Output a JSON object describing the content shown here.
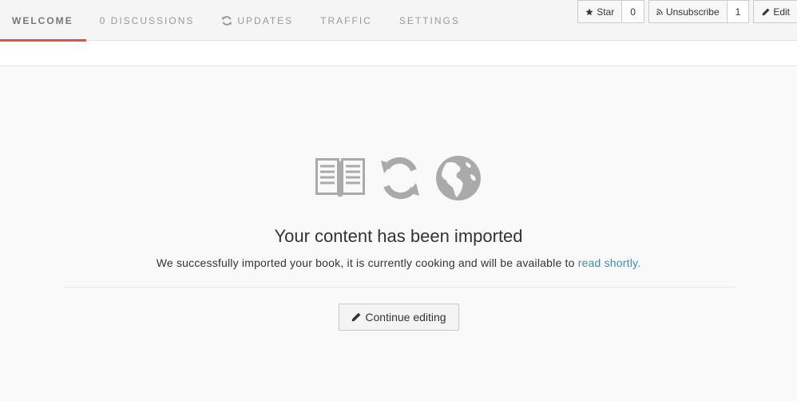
{
  "tabs": [
    {
      "label": "Welcome",
      "active": true
    },
    {
      "label": "0 Discussions"
    },
    {
      "label": "Updates",
      "icon": "refresh-icon"
    },
    {
      "label": "Traffic"
    },
    {
      "label": "Settings"
    }
  ],
  "actions": {
    "star_label": "Star",
    "star_count": "0",
    "unsubscribe_label": "Unsubscribe",
    "subscriber_count": "1",
    "edit_label": "Edit"
  },
  "main": {
    "icons": [
      "book-icon",
      "sync-icon",
      "globe-icon"
    ],
    "title": "Your content has been imported",
    "message": "We successfully imported your book, it is currently cooking and will be available to ",
    "link_text": "read shortly.",
    "continue_label": "Continue editing"
  },
  "colors": {
    "accent": "#d9534f",
    "link": "#3b8dbd",
    "icon_gray": "#aaaaaa"
  }
}
